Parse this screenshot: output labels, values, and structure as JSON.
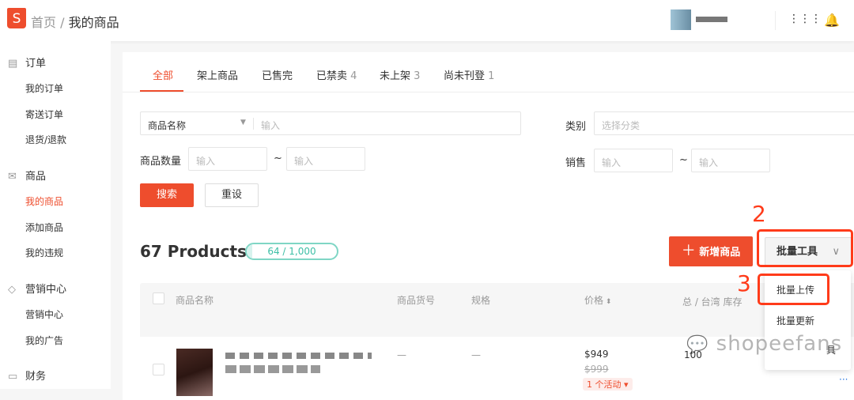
{
  "header": {
    "breadcrumb_home": "首页",
    "breadcrumb_sep": " / ",
    "breadcrumb_current": "我的商品",
    "logo": "S",
    "icons": [
      "apps-icon",
      "bell-icon"
    ]
  },
  "sidebar": [
    {
      "section": "订单",
      "icon": "clipboard-icon",
      "items": [
        "我的订单",
        "寄送订单",
        "退货/退款"
      ]
    },
    {
      "section": "商品",
      "icon": "box-icon",
      "items": [
        "我的商品",
        "添加商品",
        "我的违规"
      ]
    },
    {
      "section": "营销中心",
      "icon": "tag-icon",
      "items": [
        "营销中心",
        "我的广告"
      ]
    },
    {
      "section": "财务",
      "icon": "wallet-icon",
      "items": []
    }
  ],
  "tabs": [
    {
      "label": "全部",
      "count": ""
    },
    {
      "label": "架上商品",
      "count": ""
    },
    {
      "label": "已售完",
      "count": ""
    },
    {
      "label": "已禁卖",
      "count": "4"
    },
    {
      "label": "未上架",
      "count": "3"
    },
    {
      "label": "尚未刊登",
      "count": "1"
    }
  ],
  "filters": {
    "name_select": "商品名称",
    "name_placeholder": "输入",
    "category_label": "类别",
    "category_placeholder": "选择分类",
    "qty_label": "商品数量",
    "qty_min": "输入",
    "qty_max": "输入",
    "sales_label": "销售",
    "sales_min": "输入",
    "sales_max": "输入",
    "tilde": "~",
    "search": "搜索",
    "reset": "重设"
  },
  "products": {
    "title": "67 Products",
    "quota": "64 / 1,000",
    "quota_fraction": 0.064,
    "add_button": "新增商品",
    "bulk_button": "批量工具"
  },
  "bulk_menu": [
    "批量上传",
    "批量更新",
    "具"
  ],
  "table": {
    "headers": [
      "商品名称",
      "商品货号",
      "规格",
      "价格",
      "总 / 台湾 库存"
    ],
    "rows": [
      {
        "sku": "—",
        "variation": "—",
        "price": "$949",
        "original_price": "$999",
        "promo": "1 个活动",
        "stock": "100"
      }
    ]
  },
  "annotations": [
    "2",
    "3"
  ],
  "watermark": "shopeefans",
  "colors": {
    "accent": "#ee4d2d",
    "quota": "#4bc5ad",
    "annotation": "#ff3b1a"
  }
}
